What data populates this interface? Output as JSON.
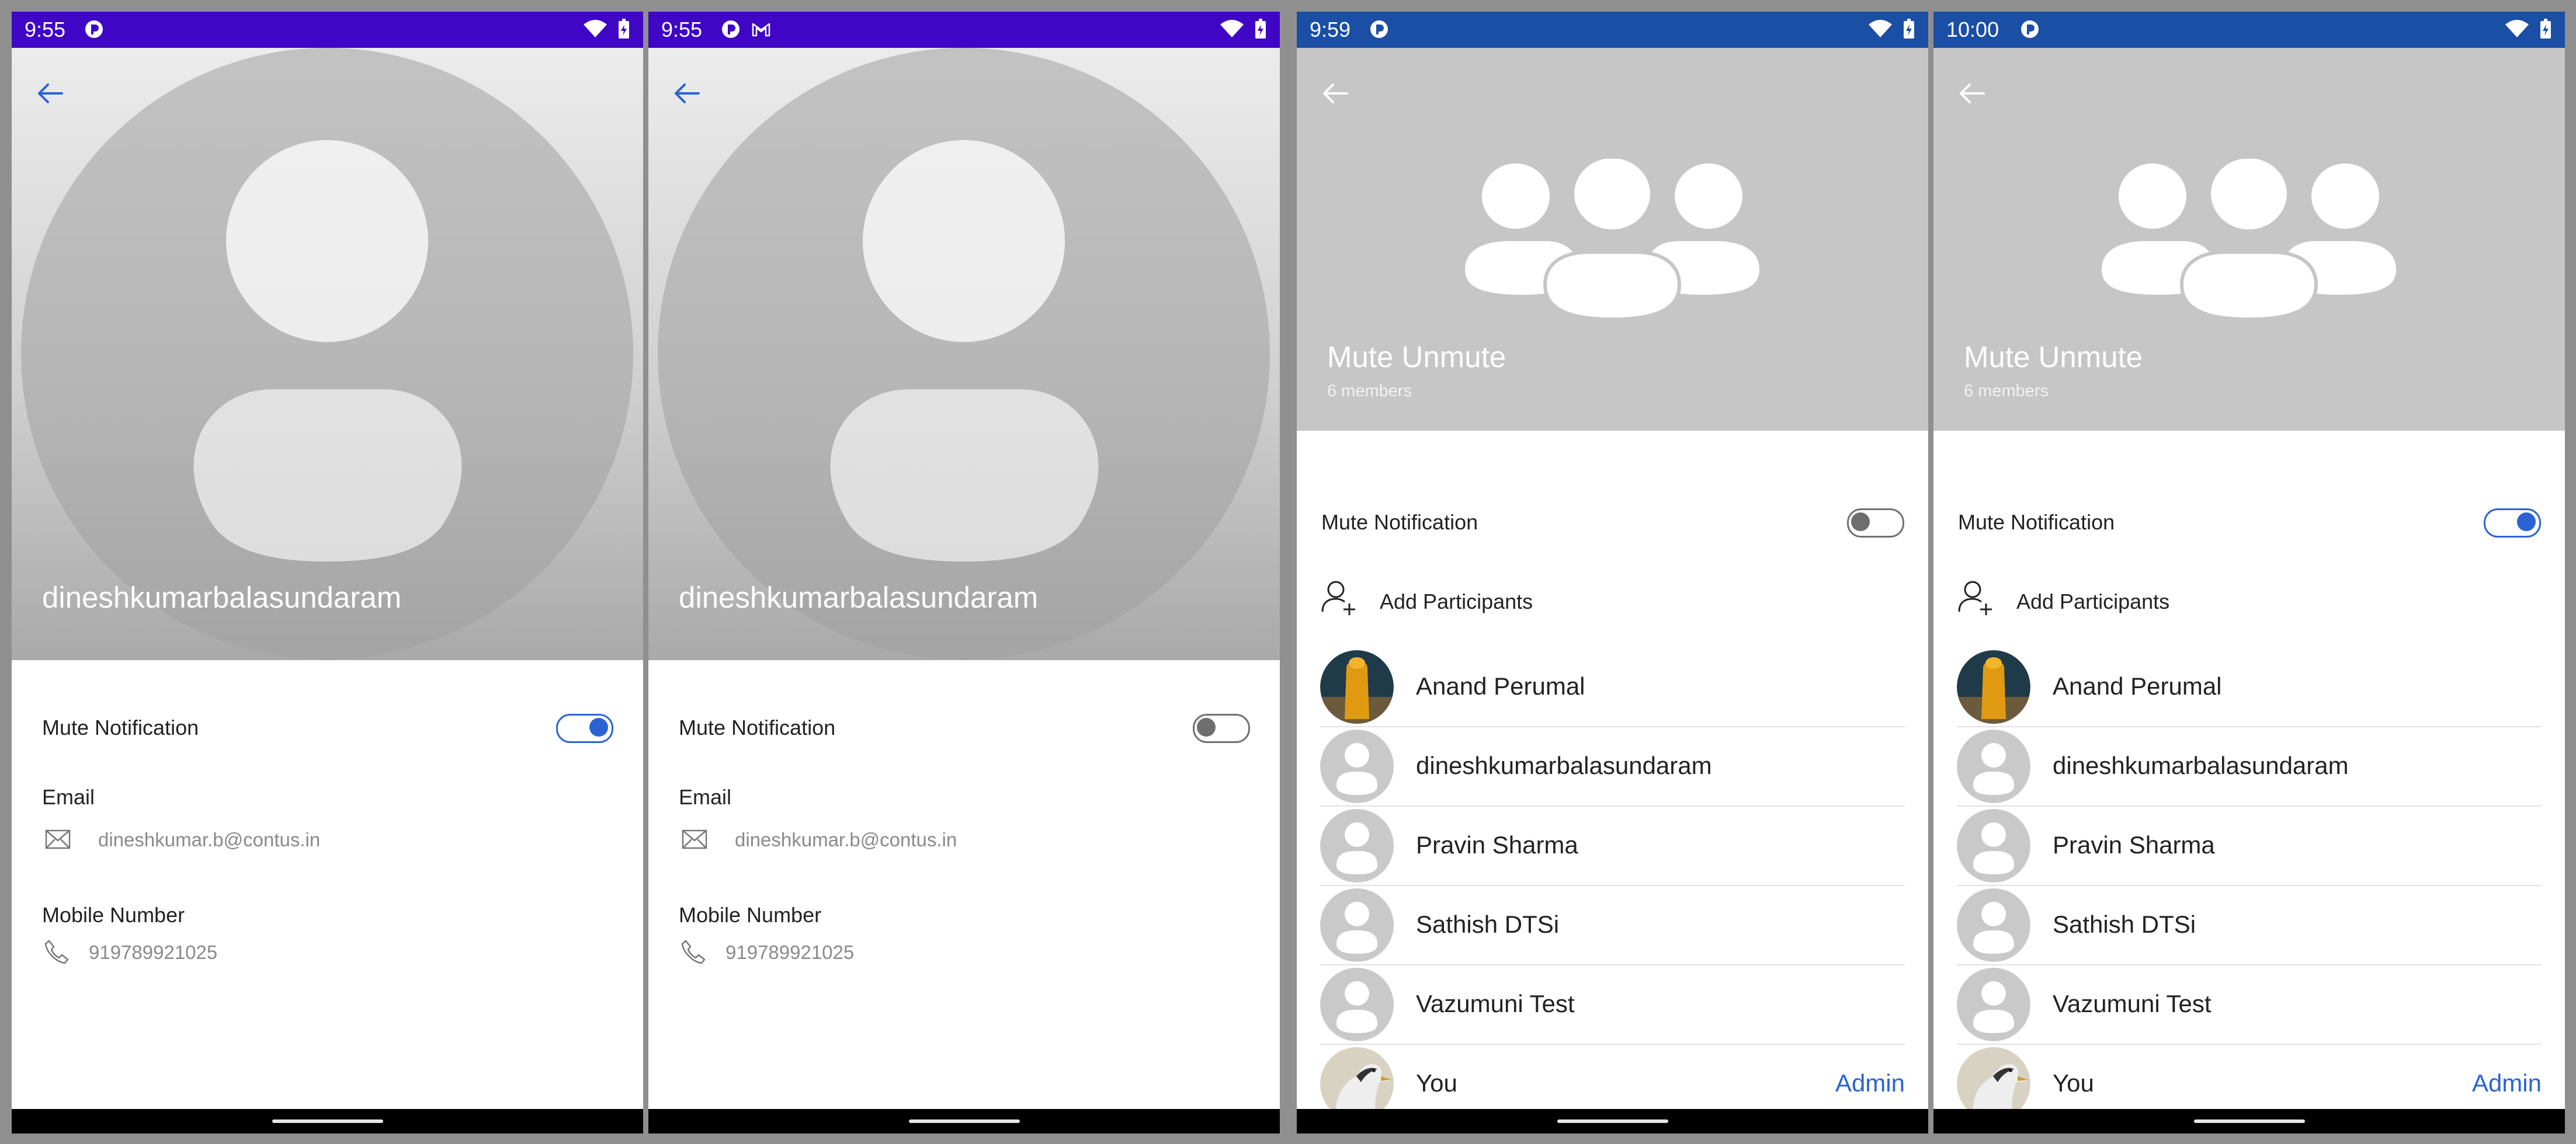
{
  "colors": {
    "status_purple": "#3f06c6",
    "status_blue": "#1b4ea5",
    "accent": "#2b63d4",
    "frame": "#8f8f8f"
  },
  "screens": [
    {
      "status": {
        "time": "9:55"
      },
      "name": "dineshkumarbalasundaram",
      "mute": {
        "label": "Mute Notification",
        "state": "on"
      },
      "email": {
        "label": "Email",
        "value": "dineshkumar.b@contus.in"
      },
      "mobile": {
        "label": "Mobile Number",
        "value": "919789921025"
      }
    },
    {
      "status": {
        "time": "9:55"
      },
      "name": "dineshkumarbalasundaram",
      "mute": {
        "label": "Mute Notification",
        "state": "off"
      },
      "email": {
        "label": "Email",
        "value": "dineshkumar.b@contus.in"
      },
      "mobile": {
        "label": "Mobile Number",
        "value": "919789921025"
      }
    },
    {
      "status": {
        "time": "9:59"
      },
      "group": {
        "name": "Mute Unmute",
        "members": "6 members"
      },
      "mute": {
        "label": "Mute Notification",
        "state": "off"
      },
      "add_participants": "Add Participants",
      "members": [
        {
          "name": "Anand Perumal",
          "avatar": "photo-orange"
        },
        {
          "name": "dineshkumarbalasundaram",
          "avatar": "placeholder"
        },
        {
          "name": "Pravin Sharma",
          "avatar": "placeholder"
        },
        {
          "name": "Sathish DTSi",
          "avatar": "placeholder"
        },
        {
          "name": "Vazumuni Test",
          "avatar": "placeholder"
        },
        {
          "name": "You",
          "avatar": "photo-bird",
          "role": "Admin"
        }
      ]
    },
    {
      "status": {
        "time": "10:00"
      },
      "group": {
        "name": "Mute Unmute",
        "members": "6 members"
      },
      "mute": {
        "label": "Mute Notification",
        "state": "on"
      },
      "add_participants": "Add Participants",
      "members": [
        {
          "name": "Anand Perumal",
          "avatar": "photo-orange"
        },
        {
          "name": "dineshkumarbalasundaram",
          "avatar": "placeholder"
        },
        {
          "name": "Pravin Sharma",
          "avatar": "placeholder"
        },
        {
          "name": "Sathish DTSi",
          "avatar": "placeholder"
        },
        {
          "name": "Vazumuni Test",
          "avatar": "placeholder"
        },
        {
          "name": "You",
          "avatar": "photo-bird",
          "role": "Admin"
        }
      ]
    }
  ]
}
